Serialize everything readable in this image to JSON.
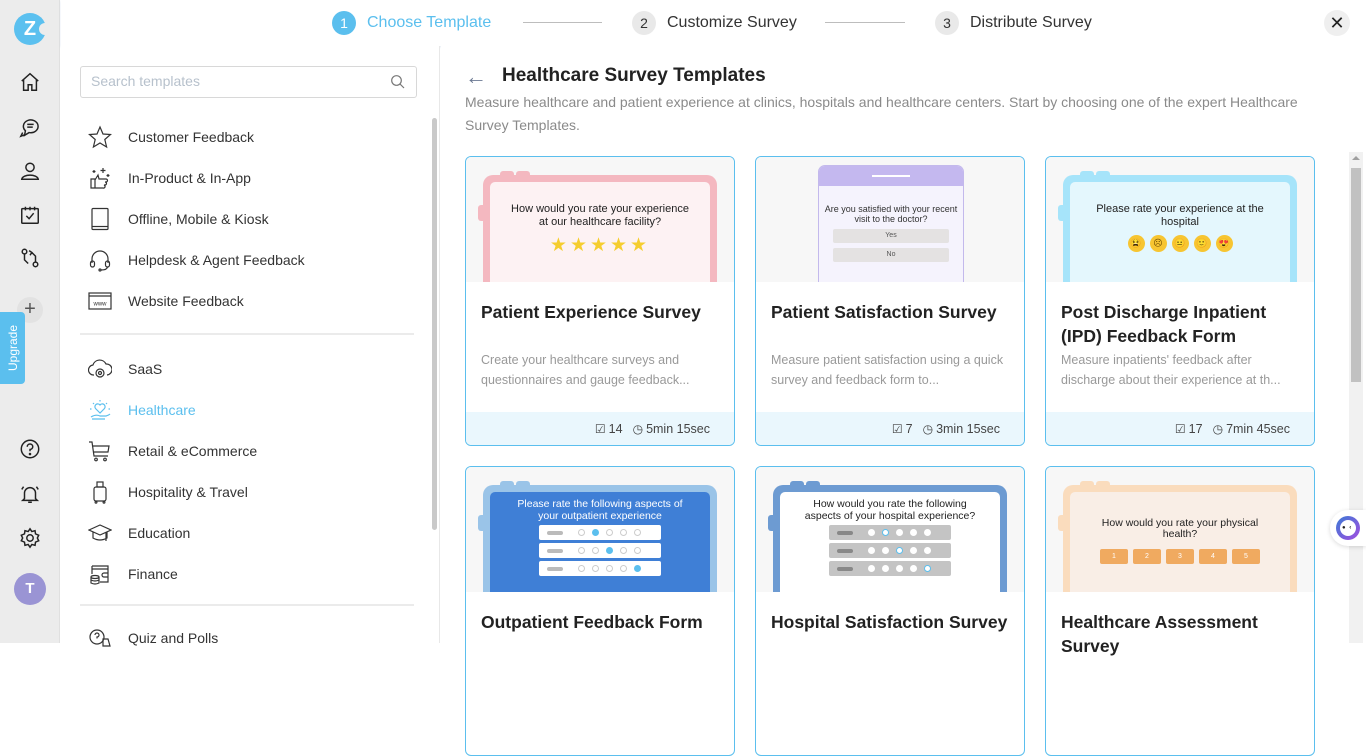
{
  "app": {
    "logo_letter": "Z",
    "upgrade_label": "Upgrade",
    "avatar_initial": "T",
    "add_label": "+"
  },
  "rail_icons": [
    "home-icon",
    "chat-icon",
    "user-icon",
    "calendar-check-icon",
    "workflow-icon",
    "help-icon",
    "bell-icon",
    "gear-icon"
  ],
  "stepper": {
    "steps": [
      {
        "number": "1",
        "label": "Choose Template",
        "active": true
      },
      {
        "number": "2",
        "label": "Customize Survey",
        "active": false
      },
      {
        "number": "3",
        "label": "Distribute Survey",
        "active": false
      }
    ],
    "close_label": "✕"
  },
  "sidebar": {
    "search_placeholder": "Search templates",
    "groups": [
      [
        {
          "label": "Customer Feedback",
          "icon": "star-icon"
        },
        {
          "label": "In-Product & In-App",
          "icon": "thumbs-up-sparkle-icon"
        },
        {
          "label": "Offline, Mobile & Kiosk",
          "icon": "tablet-icon"
        },
        {
          "label": "Helpdesk & Agent Feedback",
          "icon": "headset-icon"
        },
        {
          "label": "Website Feedback",
          "icon": "www-browser-icon"
        }
      ],
      [
        {
          "label": "SaaS",
          "icon": "cloud-gear-icon"
        },
        {
          "label": "Healthcare",
          "icon": "heart-hand-icon",
          "active": true
        },
        {
          "label": "Retail & eCommerce",
          "icon": "cart-icon"
        },
        {
          "label": "Hospitality & Travel",
          "icon": "luggage-icon"
        },
        {
          "label": "Education",
          "icon": "graduation-cap-icon"
        },
        {
          "label": "Finance",
          "icon": "wallet-coins-icon"
        }
      ],
      [
        {
          "label": "Quiz and Polls",
          "icon": "quiz-icon"
        }
      ]
    ]
  },
  "main": {
    "back_label": "←",
    "title": "Healthcare Survey Templates",
    "description": "Measure healthcare and patient experience at clinics, hospitals and healthcare centers. Start by choosing one of the expert Healthcare Survey Templates.",
    "accent_color": "#5bbfee",
    "cards": [
      {
        "title": "Patient Experience Survey",
        "description": "Create your healthcare surveys and questionnaires and gauge feedback...",
        "questions": "14",
        "duration": "5min 15sec",
        "preview": {
          "question": "How would you rate your experience at our healthcare facility?",
          "stars": "★★★★★"
        }
      },
      {
        "title": "Patient Satisfaction Survey",
        "description": "Measure patient satisfaction using a quick survey and feedback form to...",
        "questions": "7",
        "duration": "3min 15sec",
        "preview": {
          "question": "Are you satisfied with your recent visit to the doctor?",
          "options": [
            "Yes",
            "No"
          ]
        }
      },
      {
        "title": "Post Discharge Inpatient (IPD) Feedback Form",
        "description": "Measure inpatients' feedback after discharge about their experience at th...",
        "questions": "17",
        "duration": "7min 45sec",
        "preview": {
          "question": "Please rate your experience at the hospital",
          "emojis": [
            "😫",
            "☹",
            "😐",
            "🙂",
            "😍"
          ]
        }
      },
      {
        "title": "Outpatient Feedback Form",
        "preview": {
          "question": "Please rate the following aspects of your outpatient experience"
        }
      },
      {
        "title": "Hospital Satisfaction Survey",
        "preview": {
          "question": "How would you rate the following aspects of your hospital experience?"
        }
      },
      {
        "title": "Healthcare Assessment Survey",
        "preview": {
          "question": "How would you rate your physical health?",
          "scale": [
            "1",
            "2",
            "3",
            "4",
            "5"
          ]
        }
      }
    ]
  }
}
